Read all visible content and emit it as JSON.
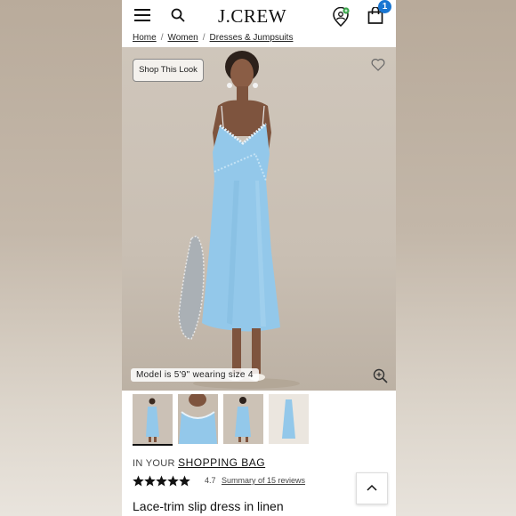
{
  "header": {
    "brand": "J.CREW",
    "cart_count": "1"
  },
  "breadcrumb": {
    "items": [
      "Home",
      "Women",
      "Dresses & Jumpsuits"
    ]
  },
  "hero": {
    "shop_look_label": "Shop This Look",
    "model_info": "Model is 5'9\" wearing size 4"
  },
  "thumbnails": [
    "thumb-front",
    "thumb-detail",
    "thumb-back",
    "thumb-flat"
  ],
  "bag": {
    "prefix": "IN YOUR ",
    "link": "SHOPPING BAG"
  },
  "rating": {
    "stars": 4.7,
    "value": "4.7",
    "summary_link": "Summary of 15 reviews"
  },
  "product": {
    "title": "Lace-trim slip dress in linen"
  },
  "colors": {
    "dress": "#93c8ea",
    "badge": "#1976d2",
    "rewards_badge": "#3aa64b"
  }
}
